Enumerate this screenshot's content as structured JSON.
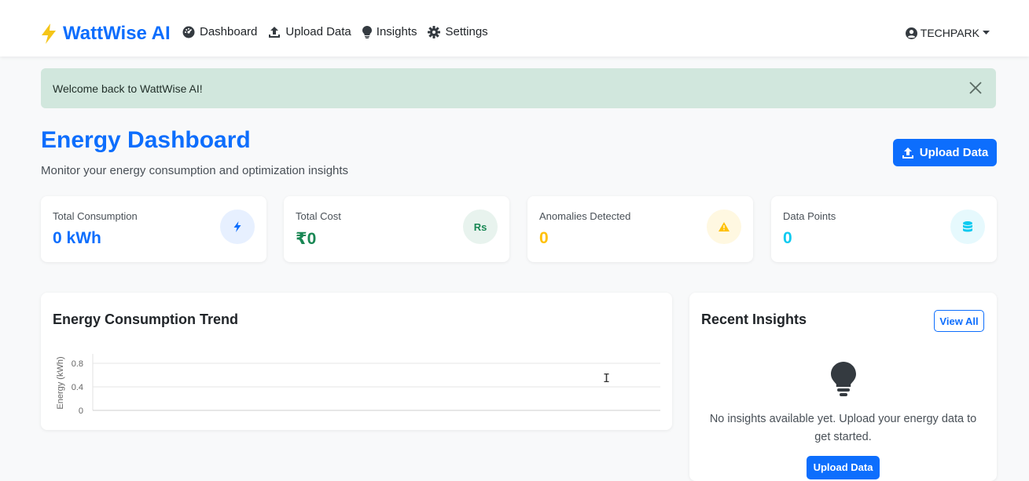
{
  "navbar": {
    "brand": "WattWise AI",
    "links": [
      {
        "label": "Dashboard",
        "icon": "dashboard-icon"
      },
      {
        "label": "Upload Data",
        "icon": "upload-icon"
      },
      {
        "label": "Insights",
        "icon": "lightbulb-icon"
      },
      {
        "label": "Settings",
        "icon": "gear-icon"
      }
    ],
    "user": "TECHPARK"
  },
  "alert": {
    "message": "Welcome back to WattWise AI!"
  },
  "header": {
    "title": "Energy Dashboard",
    "subtitle": "Monitor your energy consumption and optimization insights",
    "upload_button": "Upload Data"
  },
  "stats": [
    {
      "label": "Total Consumption",
      "value": "0 kWh",
      "icon": "bolt-icon",
      "color": "#0d6efd",
      "bg": "#e7f0ff"
    },
    {
      "label": "Total Cost",
      "value": "₹0",
      "icon": "rupee-icon",
      "icon_text": "Rs",
      "color": "#198754",
      "bg": "#e8f3ee"
    },
    {
      "label": "Anomalies Detected",
      "value": "0",
      "icon": "warning-icon",
      "color": "#ffc107",
      "bg": "#fff8e1"
    },
    {
      "label": "Data Points",
      "value": "0",
      "icon": "database-icon",
      "color": "#0dcaf0",
      "bg": "#e6f9fd"
    }
  ],
  "trend": {
    "title": "Energy Consumption Trend"
  },
  "chart_data": {
    "type": "line",
    "x": [],
    "series": [],
    "ylabel": "Energy (kWh)",
    "yticks": [
      "0.8",
      "0.4",
      "0"
    ],
    "ylim": [
      0,
      1
    ]
  },
  "insights": {
    "title": "Recent Insights",
    "view_all": "View All",
    "empty_message": "No insights available yet. Upload your energy data to get started.",
    "upload_button": "Upload Data"
  },
  "colors": {
    "primary": "#0d6efd",
    "success_bg": "#d1e7dd",
    "brand_bolt": "#f5c518"
  }
}
